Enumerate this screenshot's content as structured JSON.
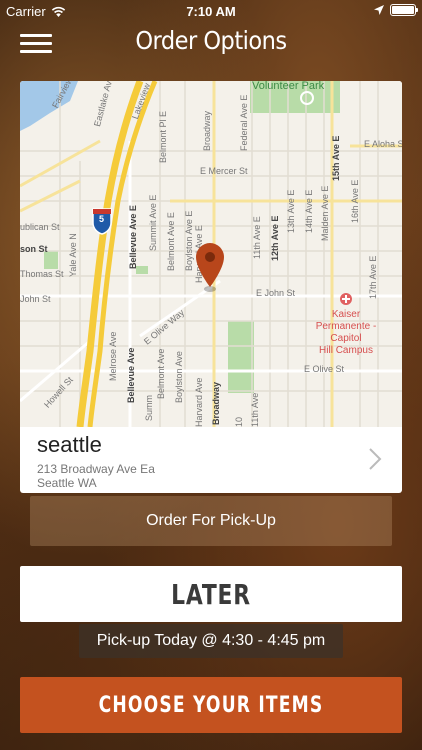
{
  "status_bar": {
    "carrier": "Carrier",
    "time": "7:10 AM",
    "icons": [
      "wifi-icon",
      "location-arrow-icon",
      "battery-icon"
    ]
  },
  "nav": {
    "title": "Order Options",
    "menu_icon": "hamburger-menu-icon"
  },
  "map": {
    "labels": {
      "volunteer_park": "Volunteer Park",
      "fairview": "Fairview Ave E",
      "eastlake": "Eastlake Ave E",
      "lakeview": "Lakeview",
      "belmont_pl": "Belmont Pl E",
      "broadway_top": "Broadway",
      "federal": "Federal Ave E",
      "e_aloha": "E Aloha St",
      "fifteenth": "15th Ave E",
      "e_mercer": "E Mercer St",
      "republican": "ublican St",
      "bellevue_top": "Bellevue Ave E",
      "summit": "Summit Ave E",
      "belmont_ave": "Belmont Ave E",
      "boylston": "Boylston Ave E",
      "harvard": "Harvard Ave E",
      "eleventh": "11th Ave E",
      "twelfth": "12th Ave E",
      "thirteenth": "13th Ave E",
      "fourteenth": "14th Ave E",
      "malden": "Malden Ave E",
      "sixteenth": "16th Ave E",
      "seventeenth": "17th Ave E",
      "yale": "Yale Ave N",
      "son_st": "son St",
      "thomas": "Thomas St",
      "john_left": "John St",
      "e_olive_way": "E Olive Way",
      "e_john": "E John St",
      "kaiser": "Kaiser\nPermanente -\nCapitol\nHill Campus",
      "howell": "Howell St",
      "melrose": "Melrose Ave",
      "bellevue_bottom": "Bellevue Ave",
      "belmont_bottom": "Belmont Ave",
      "boylston_bottom": "Boylston Ave",
      "harvard_bottom": "Harvard Ave",
      "broadway_bottom": "Broadway",
      "summit_bottom": "Summ",
      "e_olive_st": "E Olive St",
      "eleventh_bottom": "11th Ave",
      "interstate": "5",
      "ten_bottom": "10"
    },
    "pin_icon": "map-pin-icon",
    "colors": {
      "pin": "#c4521f",
      "highway": "#f5cb3a",
      "park": "#b8dca8",
      "water": "#a3c8e8"
    }
  },
  "location": {
    "name": "seattle",
    "address_line1": "213 Broadway Ave Ea",
    "address_line2": "Seattle WA"
  },
  "order_type": {
    "label": "Order For Pick-Up"
  },
  "timing": {
    "later_label": "LATER",
    "pickup_time": "Pick-up Today @ 4:30 - 4:45 pm"
  },
  "cta": {
    "label": "CHOOSE YOUR ITEMS",
    "color": "#c4521f"
  }
}
